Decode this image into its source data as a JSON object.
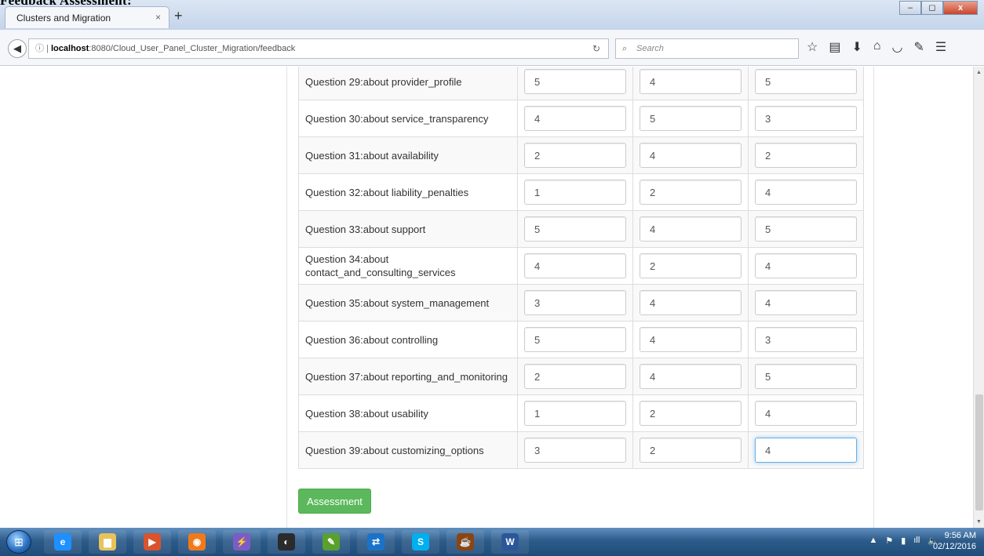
{
  "overlay_text": "Feedback Assessment:",
  "browser": {
    "tab_title": "Clusters and Migration",
    "tab_close": "×",
    "new_tab": "+",
    "url_host": "localhost",
    "url_path": ":8080/Cloud_User_Panel_Cluster_Migration/feedback",
    "search_placeholder": "Search",
    "toolbar_icons": [
      "star-icon",
      "reading-list-icon",
      "download-icon",
      "home-icon",
      "pocket-icon",
      "extension-icon",
      "menu-icon"
    ]
  },
  "questions": [
    {
      "label": "Question 29:about provider_profile",
      "values": [
        "5",
        "4",
        "5"
      ]
    },
    {
      "label": "Question 30:about service_transparency",
      "values": [
        "4",
        "5",
        "3"
      ]
    },
    {
      "label": "Question 31:about availability",
      "values": [
        "2",
        "4",
        "2"
      ]
    },
    {
      "label": "Question 32:about liability_penalties",
      "values": [
        "1",
        "2",
        "4"
      ]
    },
    {
      "label": "Question 33:about support",
      "values": [
        "5",
        "4",
        "5"
      ]
    },
    {
      "label": "Question 34:about contact_and_consulting_services",
      "values": [
        "4",
        "2",
        "4"
      ]
    },
    {
      "label": "Question 35:about system_management",
      "values": [
        "3",
        "4",
        "4"
      ]
    },
    {
      "label": "Question 36:about controlling",
      "values": [
        "5",
        "4",
        "3"
      ]
    },
    {
      "label": "Question 37:about reporting_and_monitoring",
      "values": [
        "2",
        "4",
        "5"
      ]
    },
    {
      "label": "Question 38:about usability",
      "values": [
        "1",
        "2",
        "4"
      ]
    },
    {
      "label": "Question 39:about customizing_options",
      "values": [
        "3",
        "2",
        "4"
      ]
    }
  ],
  "assessment_button": "Assessment",
  "taskbar": {
    "apps": [
      "internet-explorer",
      "file-explorer",
      "media-player",
      "firefox",
      "visual-studio",
      "vpn",
      "notepad",
      "teamviewer",
      "skype",
      "java-ee-ide",
      "word"
    ],
    "time": "9:56 AM",
    "date": "02/12/2016"
  },
  "colors": {
    "button_green": "#5cb85c",
    "focus_blue": "#66afe9",
    "taskbar": "#2e5c8a"
  }
}
